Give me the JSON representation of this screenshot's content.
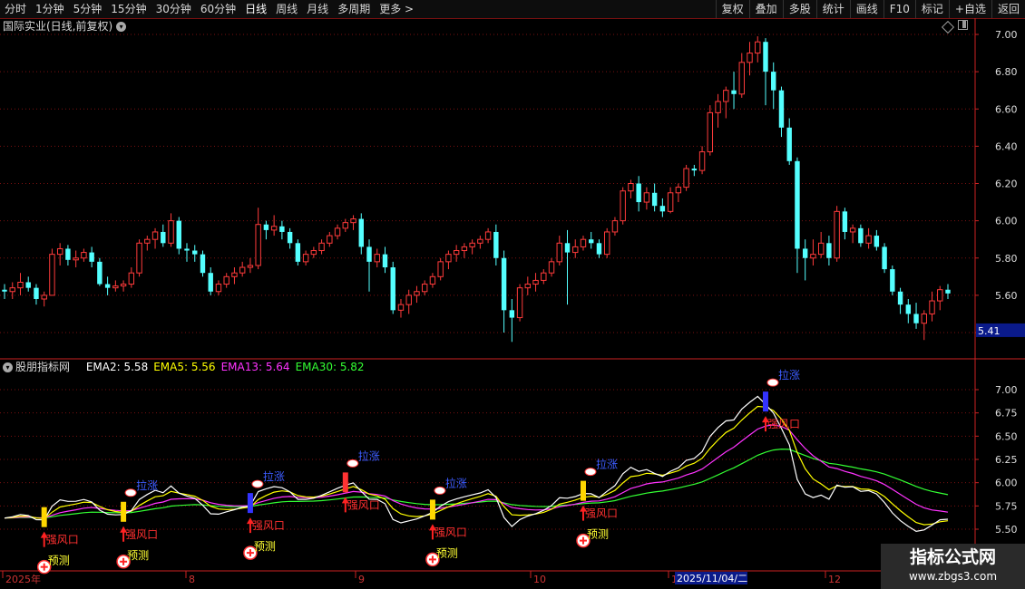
{
  "toolbar": {
    "periods": [
      "分时",
      "1分钟",
      "5分钟",
      "15分钟",
      "30分钟",
      "60分钟",
      "日线",
      "周线",
      "月线",
      "多周期",
      "更多 >"
    ],
    "active_index": 6,
    "right_items": [
      "复权",
      "叠加",
      "多股",
      "统计",
      "画线",
      "F10",
      "标记",
      "+自选",
      "返回"
    ]
  },
  "main_chart": {
    "title": "国际实业(日线,前复权)",
    "y_ticks": [
      "7.00",
      "6.80",
      "6.60",
      "6.40",
      "6.20",
      "6.00",
      "5.80",
      "5.60",
      "5.40"
    ],
    "current_price": "5.41"
  },
  "indicator": {
    "name": "股朋指标网",
    "labels": [
      {
        "text": "EMA2: 5.58",
        "color": "#ffffff"
      },
      {
        "text": "EMA5: 5.56",
        "color": "#ffff00"
      },
      {
        "text": "EMA13: 5.64",
        "color": "#ff33ff"
      },
      {
        "text": "EMA30: 5.82",
        "color": "#33ff33"
      }
    ],
    "y_ticks": [
      "7.00",
      "6.75",
      "6.50",
      "6.25",
      "6.00",
      "5.75",
      "5.50"
    ],
    "signals": {
      "strong": "强风口",
      "up": "拉涨",
      "pre": "预测"
    }
  },
  "x_axis": {
    "labels": [
      "2025年",
      "8",
      "9",
      "10",
      "11",
      "12"
    ],
    "cursor_date": "2025/11/04/二"
  },
  "watermark": {
    "line1": "指标公式网",
    "line2": "www.zbgs3.com"
  },
  "colors": {
    "up": "#ff3b3b",
    "down": "#54ffff",
    "grid": "#7a1010",
    "axis": "#cc2222"
  },
  "chart_data": {
    "type": "candlestick",
    "price_ylim": [
      5.3,
      7.05
    ],
    "ohlc": [
      [
        5.63,
        5.66,
        5.58,
        5.62
      ],
      [
        5.62,
        5.67,
        5.58,
        5.64
      ],
      [
        5.64,
        5.72,
        5.6,
        5.67
      ],
      [
        5.67,
        5.7,
        5.62,
        5.64
      ],
      [
        5.64,
        5.66,
        5.55,
        5.58
      ],
      [
        5.58,
        5.62,
        5.54,
        5.6
      ],
      [
        5.6,
        5.85,
        5.6,
        5.82
      ],
      [
        5.82,
        5.88,
        5.76,
        5.85
      ],
      [
        5.85,
        5.87,
        5.76,
        5.79
      ],
      [
        5.79,
        5.84,
        5.75,
        5.8
      ],
      [
        5.8,
        5.85,
        5.78,
        5.83
      ],
      [
        5.83,
        5.86,
        5.75,
        5.78
      ],
      [
        5.78,
        5.8,
        5.65,
        5.66
      ],
      [
        5.66,
        5.7,
        5.6,
        5.64
      ],
      [
        5.64,
        5.68,
        5.62,
        5.65
      ],
      [
        5.65,
        5.68,
        5.62,
        5.66
      ],
      [
        5.66,
        5.75,
        5.64,
        5.72
      ],
      [
        5.72,
        5.9,
        5.7,
        5.88
      ],
      [
        5.88,
        5.92,
        5.84,
        5.9
      ],
      [
        5.9,
        5.96,
        5.85,
        5.94
      ],
      [
        5.94,
        5.98,
        5.86,
        5.88
      ],
      [
        5.88,
        6.04,
        5.86,
        6.0
      ],
      [
        6.0,
        6.02,
        5.82,
        5.85
      ],
      [
        5.85,
        5.88,
        5.78,
        5.84
      ],
      [
        5.84,
        5.87,
        5.78,
        5.82
      ],
      [
        5.82,
        5.84,
        5.7,
        5.72
      ],
      [
        5.72,
        5.75,
        5.6,
        5.62
      ],
      [
        5.62,
        5.68,
        5.6,
        5.66
      ],
      [
        5.66,
        5.72,
        5.64,
        5.7
      ],
      [
        5.7,
        5.75,
        5.66,
        5.72
      ],
      [
        5.72,
        5.78,
        5.7,
        5.75
      ],
      [
        5.75,
        5.8,
        5.72,
        5.76
      ],
      [
        5.76,
        6.07,
        5.74,
        5.98
      ],
      [
        5.98,
        6.0,
        5.9,
        5.95
      ],
      [
        5.95,
        6.03,
        5.92,
        5.97
      ],
      [
        5.97,
        6.0,
        5.9,
        5.94
      ],
      [
        5.94,
        5.96,
        5.85,
        5.88
      ],
      [
        5.88,
        5.9,
        5.76,
        5.78
      ],
      [
        5.78,
        5.84,
        5.76,
        5.82
      ],
      [
        5.82,
        5.86,
        5.8,
        5.84
      ],
      [
        5.84,
        5.9,
        5.82,
        5.88
      ],
      [
        5.88,
        5.94,
        5.86,
        5.92
      ],
      [
        5.92,
        5.98,
        5.9,
        5.96
      ],
      [
        5.96,
        6.01,
        5.94,
        5.99
      ],
      [
        5.99,
        6.03,
        5.95,
        6.01
      ],
      [
        6.01,
        6.04,
        5.82,
        5.86
      ],
      [
        5.86,
        5.9,
        5.62,
        5.78
      ],
      [
        5.78,
        5.85,
        5.75,
        5.82
      ],
      [
        5.82,
        5.86,
        5.72,
        5.75
      ],
      [
        5.75,
        5.78,
        5.5,
        5.52
      ],
      [
        5.52,
        5.58,
        5.48,
        5.55
      ],
      [
        5.55,
        5.63,
        5.5,
        5.6
      ],
      [
        5.6,
        5.65,
        5.56,
        5.62
      ],
      [
        5.62,
        5.68,
        5.6,
        5.66
      ],
      [
        5.66,
        5.72,
        5.64,
        5.7
      ],
      [
        5.7,
        5.8,
        5.68,
        5.78
      ],
      [
        5.78,
        5.84,
        5.74,
        5.82
      ],
      [
        5.82,
        5.87,
        5.78,
        5.84
      ],
      [
        5.84,
        5.88,
        5.8,
        5.86
      ],
      [
        5.86,
        5.9,
        5.82,
        5.88
      ],
      [
        5.88,
        5.92,
        5.85,
        5.9
      ],
      [
        5.9,
        5.96,
        5.88,
        5.94
      ],
      [
        5.94,
        5.98,
        5.76,
        5.8
      ],
      [
        5.8,
        5.84,
        5.4,
        5.52
      ],
      [
        5.52,
        5.58,
        5.35,
        5.48
      ],
      [
        5.48,
        5.66,
        5.46,
        5.64
      ],
      [
        5.64,
        5.7,
        5.6,
        5.66
      ],
      [
        5.66,
        5.72,
        5.62,
        5.68
      ],
      [
        5.68,
        5.74,
        5.66,
        5.72
      ],
      [
        5.72,
        5.8,
        5.7,
        5.78
      ],
      [
        5.78,
        5.92,
        5.76,
        5.88
      ],
      [
        5.88,
        5.95,
        5.55,
        5.83
      ],
      [
        5.83,
        5.9,
        5.8,
        5.86
      ],
      [
        5.86,
        5.92,
        5.84,
        5.9
      ],
      [
        5.9,
        5.94,
        5.85,
        5.88
      ],
      [
        5.88,
        5.9,
        5.8,
        5.82
      ],
      [
        5.82,
        5.96,
        5.8,
        5.94
      ],
      [
        5.94,
        6.02,
        5.92,
        6.0
      ],
      [
        6.0,
        6.18,
        5.98,
        6.16
      ],
      [
        6.16,
        6.22,
        6.12,
        6.2
      ],
      [
        6.2,
        6.24,
        6.05,
        6.1
      ],
      [
        6.1,
        6.18,
        6.06,
        6.15
      ],
      [
        6.15,
        6.2,
        6.05,
        6.08
      ],
      [
        6.08,
        6.12,
        6.02,
        6.05
      ],
      [
        6.05,
        6.18,
        6.04,
        6.15
      ],
      [
        6.15,
        6.2,
        6.1,
        6.18
      ],
      [
        6.18,
        6.3,
        6.16,
        6.28
      ],
      [
        6.28,
        6.3,
        6.24,
        6.27
      ],
      [
        6.27,
        6.4,
        6.25,
        6.37
      ],
      [
        6.37,
        6.62,
        6.35,
        6.58
      ],
      [
        6.58,
        6.68,
        6.5,
        6.64
      ],
      [
        6.64,
        6.72,
        6.55,
        6.7
      ],
      [
        6.7,
        6.8,
        6.6,
        6.68
      ],
      [
        6.68,
        6.9,
        6.66,
        6.85
      ],
      [
        6.85,
        6.96,
        6.78,
        6.9
      ],
      [
        6.9,
        6.99,
        6.85,
        6.96
      ],
      [
        6.96,
        6.98,
        6.62,
        6.8
      ],
      [
        6.8,
        6.85,
        6.6,
        6.7
      ],
      [
        6.7,
        6.72,
        6.45,
        6.5
      ],
      [
        6.5,
        6.55,
        6.3,
        6.32
      ],
      [
        6.32,
        6.34,
        5.72,
        5.85
      ],
      [
        5.85,
        5.9,
        5.68,
        5.8
      ],
      [
        5.8,
        5.9,
        5.76,
        5.82
      ],
      [
        5.82,
        5.94,
        5.8,
        5.88
      ],
      [
        5.88,
        5.92,
        5.76,
        5.8
      ],
      [
        5.8,
        6.08,
        5.78,
        6.05
      ],
      [
        6.05,
        6.07,
        5.9,
        5.94
      ],
      [
        5.94,
        5.98,
        5.88,
        5.96
      ],
      [
        5.96,
        5.98,
        5.86,
        5.88
      ],
      [
        5.88,
        5.96,
        5.85,
        5.92
      ],
      [
        5.92,
        5.95,
        5.84,
        5.86
      ],
      [
        5.86,
        5.88,
        5.72,
        5.74
      ],
      [
        5.74,
        5.76,
        5.6,
        5.62
      ],
      [
        5.62,
        5.64,
        5.5,
        5.55
      ],
      [
        5.55,
        5.58,
        5.45,
        5.5
      ],
      [
        5.5,
        5.56,
        5.42,
        5.45
      ],
      [
        5.45,
        5.52,
        5.36,
        5.5
      ],
      [
        5.5,
        5.62,
        5.46,
        5.57
      ],
      [
        5.57,
        5.65,
        5.52,
        5.63
      ],
      [
        5.63,
        5.66,
        5.58,
        5.61
      ]
    ],
    "ema_ylim": [
      5.4,
      7.1
    ],
    "series": [
      {
        "name": "EMA2"
      },
      {
        "name": "EMA5"
      },
      {
        "name": "EMA13"
      },
      {
        "name": "EMA30"
      }
    ],
    "signal_indices": [
      {
        "i": 5,
        "kind": "strong",
        "pre": true,
        "color": "#ffd700"
      },
      {
        "i": 15,
        "kind": "strong",
        "pre": true,
        "up": true,
        "color": "#ffd700"
      },
      {
        "i": 31,
        "kind": "strong",
        "pre": true,
        "up": true,
        "color": "#3333ff"
      },
      {
        "i": 43,
        "kind": "strong",
        "up": true,
        "color": "#ff3333"
      },
      {
        "i": 54,
        "kind": "strong",
        "pre": true,
        "up": true,
        "color": "#ffd700"
      },
      {
        "i": 73,
        "kind": "strong",
        "pre": true,
        "up": true,
        "color": "#ffd700"
      },
      {
        "i": 96,
        "kind": "strong",
        "up": true,
        "color": "#3333ff"
      }
    ]
  }
}
